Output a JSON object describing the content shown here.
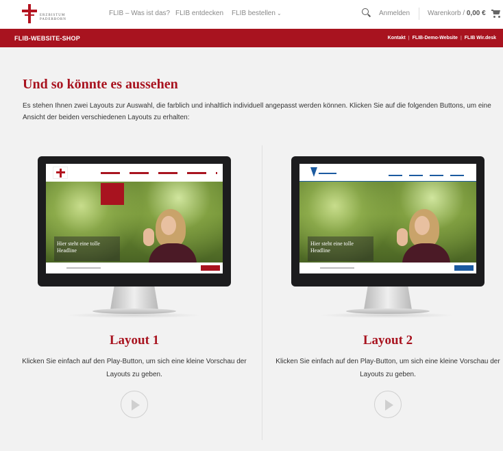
{
  "header": {
    "logo_line1": "ERZBISTUM",
    "logo_line2": "PADERBORN",
    "nav": [
      {
        "label": "FLIB – Was ist das?"
      },
      {
        "label": "FLIB entdecken"
      },
      {
        "label": "FLIB bestellen",
        "chevron": "⌄"
      }
    ],
    "login_label": "Anmelden",
    "cart_label": "Warenkorb /",
    "cart_amount": "0,00 €"
  },
  "shopbar": {
    "title": "FLIB-WEBSITE-SHOP",
    "links": [
      "Kontakt",
      "FLIB-Demo-Website",
      "FLIB Wir.desk"
    ],
    "separator": "|"
  },
  "main": {
    "headline": "Und so könnte es aussehen",
    "intro": "Es stehen Ihnen zwei Layouts zur Auswahl, die farblich und inhaltlich individuell angepasst werden können. Klicken Sie auf die folgenden Buttons, um eine Ansicht der beiden verschiedenen Layouts zu erhalten:",
    "layouts": [
      {
        "title": "Layout 1",
        "description": "Klicken Sie einfach auf den Play-Button, um sich eine kleine Vorschau der Layouts zu geben.",
        "preview_headline": "Hier steht eine tolle Headline",
        "accent": "#a8131f"
      },
      {
        "title": "Layout 2",
        "description": "Klicken Sie einfach auf den Play-Button, um sich eine kleine Vorschau der Layouts zu geben.",
        "preview_headline": "Hier steht eine tolle Headline",
        "accent": "#1b5aa0"
      }
    ]
  },
  "colors": {
    "brand_red": "#a8131f",
    "background": "#f2f2f2"
  },
  "icons": [
    "search-icon",
    "cart-icon",
    "play-icon",
    "cross-logo-icon"
  ]
}
